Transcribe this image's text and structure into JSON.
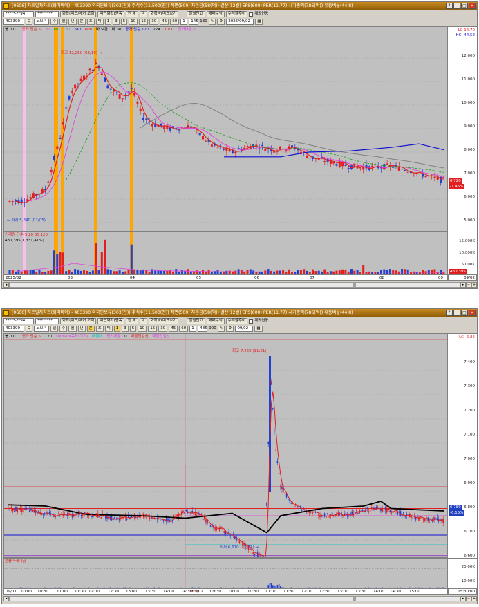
{
  "window1": {
    "title": "[0606] 차트일자차트(화미바이) - 403390 외국인보유(303(천)) 주식수(11,500(천)) 적면(500) 자본금(58(억)) 결산(12월) EPS(600) PER(11.77) 시가총액(786(억)) 유통비율(44.8)",
    "toolbar1": {
      "account": "*****-**94",
      "password": "********",
      "buttons": [
        "화확(미크/매커 조회",
        "미근화확(종목",
        "전 체",
        "미",
        "화확바(미크보기",
        "일별잔고",
        "매매수익",
        "수익률추이",
        "계좌연동"
      ]
    },
    "toolbar2": {
      "code": "403390",
      "name": "코오미",
      "periods": [
        "주",
        "월",
        "년",
        "분",
        "초",
        "틱"
      ],
      "minutes": [
        "1",
        "3",
        "5",
        "10",
        "15",
        "30",
        "45",
        "60"
      ],
      "count": "1",
      "bars": "145",
      "max_bars": "180",
      "date": "2025/09/02"
    },
    "price_legend": [
      "봉 0.01",
      "종가 단순 5",
      "20",
      "60",
      "120",
      "240",
      "600",
      "바 보관",
      "바 30",
      "종가 단순 120",
      "224",
      "1000",
      "전거래률 0"
    ],
    "price_axis": {
      "top_labels": [
        "LC 14.70",
        "HC -44.52"
      ],
      "ticks": [
        "12,000",
        "11,000",
        "10,000",
        "9,000",
        "8,000",
        "7,000",
        "6,000",
        "5,000"
      ],
      "current_price": "6,720",
      "current_change": "-1.46%"
    },
    "annotations": {
      "high": "최고 12,280 (03/19) →",
      "low": "← 최저 5,840 (02/05)"
    },
    "volume_legend": "거래량 단순 5 20 60 120",
    "volume_value": "480,395(1,331,41%)",
    "volume_axis": {
      "ticks": [
        "15,000K",
        "10,000K",
        "5,000K"
      ],
      "current": "480,395",
      "current_pct": "-1,331.41%"
    },
    "x_labels": [
      "2025/02",
      "03",
      "04",
      "05",
      "06",
      "07",
      "08",
      "09"
    ],
    "x_right": "09/02"
  },
  "window2": {
    "title": "[0606] 차트일자차트(화미바이) - 403390 외국인보유(303(천)) 주식수(11,500(천)) 적면(500) 자본금(58(억)) 결산(12월) EPS(600) PER(11.77) 시가총액(786(억)) 유통비율(44.8)",
    "toolbar1": {
      "account": "*****-**94",
      "password": "********",
      "buttons": [
        "화확(미크/매커 조회",
        "미근화확(종목",
        "전 체",
        "미",
        "화확바(미크보기",
        "일별잔고",
        "매매수익",
        "수익률추이",
        "계좌연동"
      ]
    },
    "toolbar2": {
      "code": "403390",
      "name": "코오미",
      "periods": [
        "일",
        "주",
        "월",
        "년",
        "분",
        "초",
        "틱"
      ],
      "minutes": [
        "1",
        "3",
        "5",
        "10",
        "15",
        "30",
        "45",
        "60"
      ],
      "count": "1",
      "bars": "485",
      "max_bars": "900",
      "date": "09/02"
    },
    "price_legend": [
      "봉 0.01",
      "종가 단순 5",
      "120",
      "Demark목표(고가)",
      "매물대",
      "전기매출",
      "0",
      "매물전일선",
      "매물전일선"
    ],
    "price_axis": {
      "top_labels": [
        "LC -6.86"
      ],
      "ticks": [
        "7,400",
        "7,300",
        "7,200",
        "7,100",
        "7,000",
        "6,900",
        "6,800",
        "6,700",
        "6,600"
      ],
      "current_price": "6,780",
      "current_change": "-0.15%"
    },
    "annotations": {
      "high": "최고 7,460 (11:21) →",
      "low": "최저 6,610 (11:07) →"
    },
    "volume_legend": "분봉거래대금",
    "volume_axis": {
      "ticks": [
        "20.00K",
        "10.00K"
      ]
    },
    "x_labels": [
      "09/01",
      "10:00",
      "10:30",
      "11:00",
      "11:30",
      "12:00",
      "12:30",
      "13:00",
      "13:30",
      "14:00",
      "14:30",
      "15:00",
      "09/02",
      "09:30",
      "10:00",
      "10:30",
      "11:00",
      "11:30",
      "12:00",
      "12:30",
      "13:00",
      "13:30",
      "14:00",
      "14:30",
      "15:00"
    ],
    "x_right": "15:30:00"
  },
  "colors": {
    "up": "#e02020",
    "down": "#2040d0",
    "chart_bg": "#c0c0c0",
    "highlight": "#ffa500",
    "pink_band": "#f8c0e8",
    "ma_black": "#000000",
    "ma_magenta": "#e040e0",
    "ma_gray": "#808080",
    "ma_blue": "#1010d0",
    "ma_green": "#10a010"
  }
}
